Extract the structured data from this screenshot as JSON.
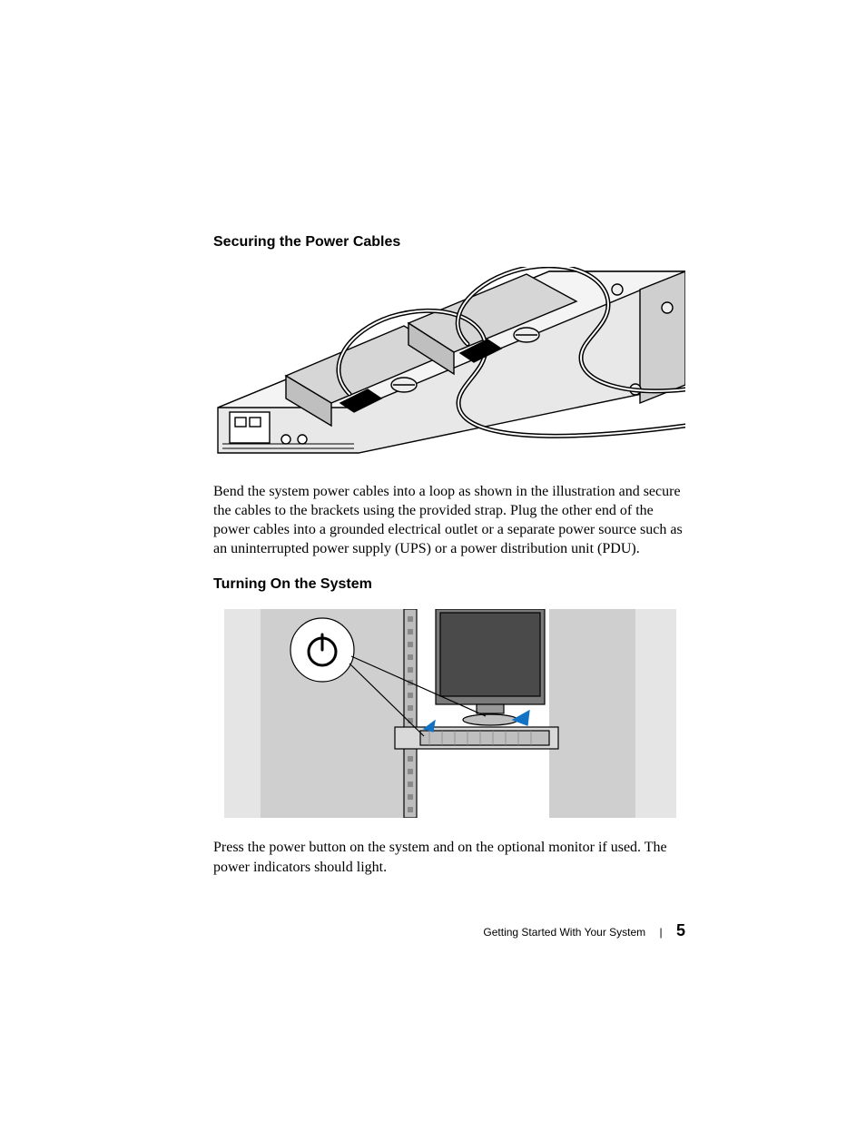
{
  "section1": {
    "heading": "Securing the Power Cables",
    "body": "Bend the system power cables into a loop as shown in the illustration and secure the cables to the brackets using the provided strap. Plug the other end of the power cables into a grounded electrical outlet or a separate power source such as an uninterrupted power supply (UPS) or a power distribution unit (PDU)."
  },
  "section2": {
    "heading": "Turning On the System",
    "body": "Press the power button on the system and on the optional monitor if used. The power indicators should light."
  },
  "footer": {
    "section_title": "Getting Started With Your System",
    "page_number": "5"
  }
}
